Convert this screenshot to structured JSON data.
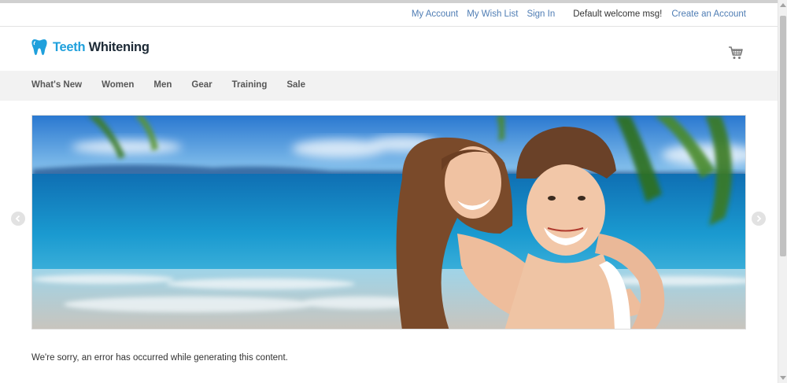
{
  "top_links": {
    "my_account": "My Account",
    "my_wish_list": "My Wish List",
    "sign_in": "Sign In",
    "welcome": "Default welcome msg!",
    "create_account": "Create an Account"
  },
  "logo": {
    "word1": "Teeth",
    "word2": "Whitening",
    "icon": "tooth-icon",
    "color_primary": "#1fa0dc",
    "color_secondary": "#1d2a36"
  },
  "cart": {
    "icon": "shopping-cart-icon"
  },
  "nav": {
    "items": [
      {
        "label": "What's New"
      },
      {
        "label": "Women"
      },
      {
        "label": "Men"
      },
      {
        "label": "Gear"
      },
      {
        "label": "Training"
      },
      {
        "label": "Sale"
      }
    ]
  },
  "slider": {
    "image": "banner-beach-couple-smiling",
    "prev_icon": "chevron-left-icon",
    "next_icon": "chevron-right-icon"
  },
  "content": {
    "error_message": "We're sorry, an error has occurred while generating this content."
  },
  "colors": {
    "link": "#4f7db4",
    "nav_bg": "#f2f2f2",
    "nav_text": "#575757"
  }
}
